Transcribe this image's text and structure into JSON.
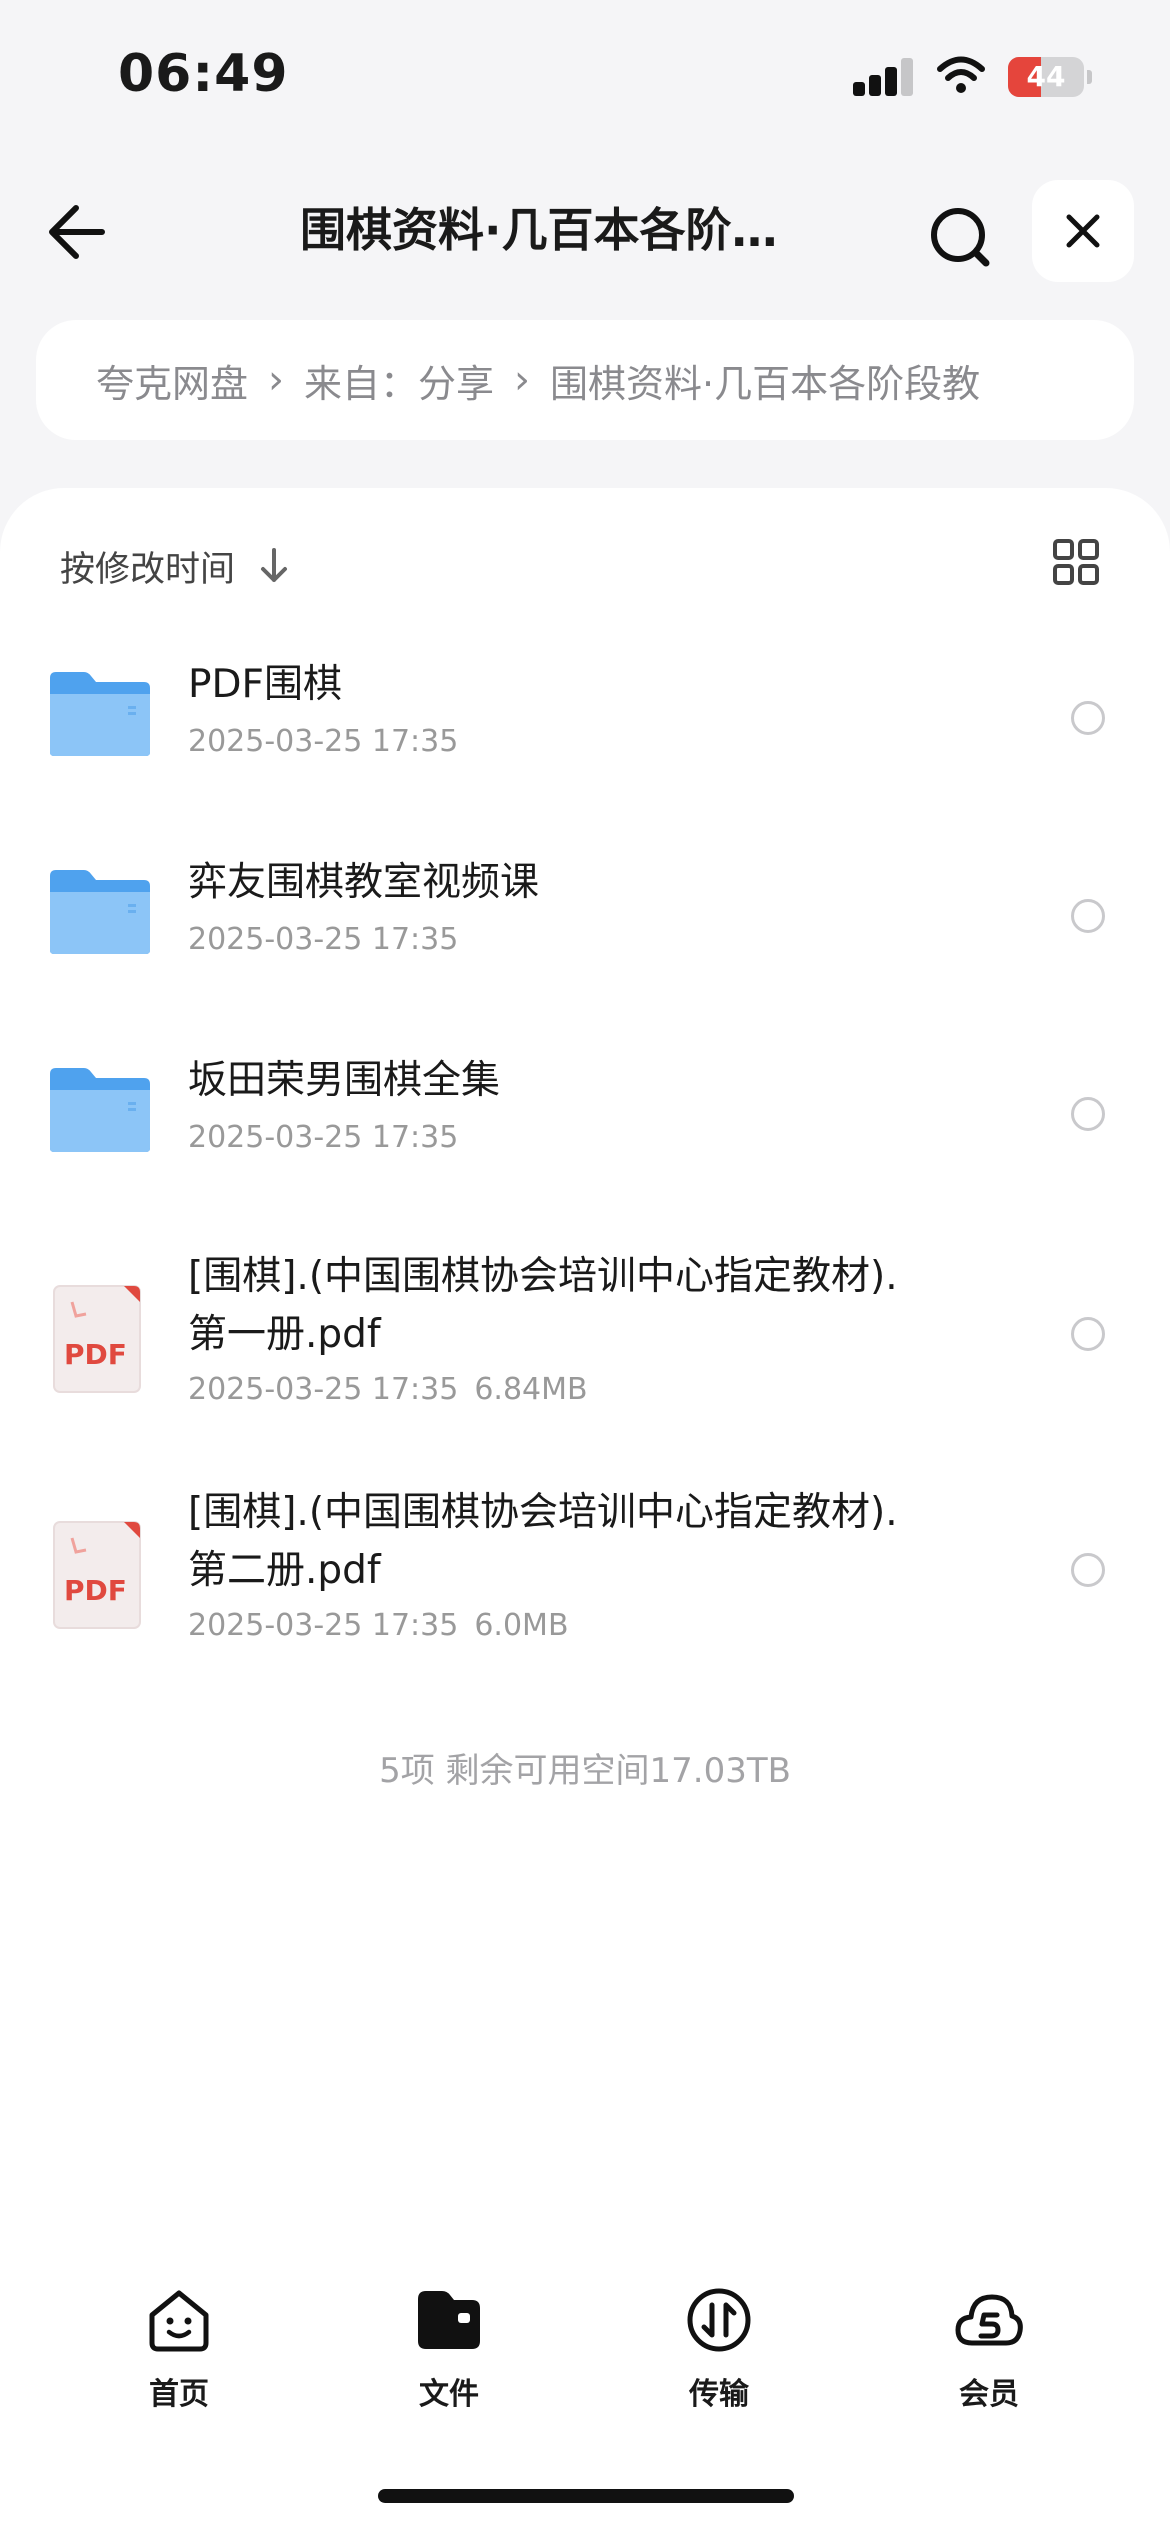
{
  "status_bar": {
    "time": "06:49",
    "battery_level": "44"
  },
  "header": {
    "title": "围棋资料·几百本各阶…",
    "back_icon": "arrow-left-icon",
    "search_icon": "search-icon",
    "close_icon": "close-icon"
  },
  "breadcrumb": {
    "items": [
      "夸克网盘",
      "来自：分享",
      "围棋资料·几百本各阶段教"
    ]
  },
  "toolbar": {
    "sort_label": "按修改时间",
    "sort_icon": "arrow-down-icon",
    "view_icon": "grid-view-icon"
  },
  "files": [
    {
      "type": "folder",
      "icon": "folder-icon",
      "name": "PDF围棋",
      "date": "2025-03-25 17:35",
      "size": ""
    },
    {
      "type": "folder",
      "icon": "folder-icon",
      "name": "弈友围棋教室视频课",
      "date": "2025-03-25 17:35",
      "size": ""
    },
    {
      "type": "folder",
      "icon": "folder-icon",
      "name": "坂田荣男围棋全集",
      "date": "2025-03-25 17:35",
      "size": ""
    },
    {
      "type": "pdf",
      "icon": "pdf-file-icon",
      "name_line1": "[围棋].(中国围棋协会培训中心指定教材).",
      "name_line2": "第一册.pdf",
      "date": "2025-03-25 17:35",
      "size": "6.84MB"
    },
    {
      "type": "pdf",
      "icon": "pdf-file-icon",
      "name_line1": "[围棋].(中国围棋协会培训中心指定教材).",
      "name_line2": "第二册.pdf",
      "date": "2025-03-25 17:35",
      "size": "6.0MB"
    }
  ],
  "pdf_badge": "PDF",
  "summary": "5项 剩余可用空间17.03TB",
  "tabbar": {
    "tabs": [
      {
        "label": "首页",
        "icon": "home-smile-icon"
      },
      {
        "label": "文件",
        "icon": "folder-filled-icon"
      },
      {
        "label": "传输",
        "icon": "transfer-icon"
      },
      {
        "label": "会员",
        "icon": "membership-cloud-icon"
      }
    ]
  }
}
